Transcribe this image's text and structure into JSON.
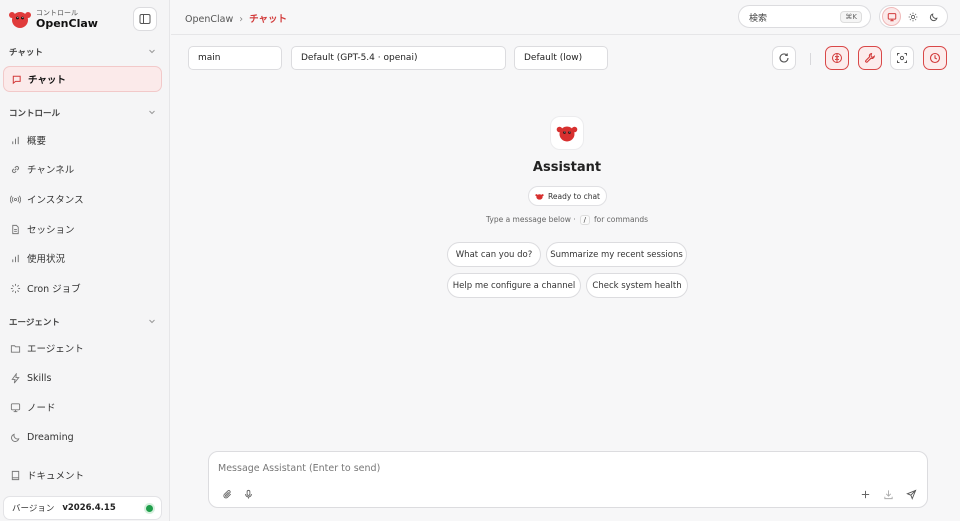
{
  "brand": {
    "subtitle": "コントロール",
    "title": "OpenClaw"
  },
  "sidebar": {
    "sections": [
      {
        "label": "チャット"
      },
      {
        "label": "コントロール"
      },
      {
        "label": "エージェント"
      }
    ],
    "items": [
      {
        "label": "チャット",
        "icon": "chat-icon"
      },
      {
        "label": "概要",
        "icon": "bar-chart-icon"
      },
      {
        "label": "チャンネル",
        "icon": "link-icon"
      },
      {
        "label": "インスタンス",
        "icon": "broadcast-icon"
      },
      {
        "label": "セッション",
        "icon": "document-icon"
      },
      {
        "label": "使用状況",
        "icon": "bar-chart-icon"
      },
      {
        "label": "Cron ジョブ",
        "icon": "loader-icon"
      },
      {
        "label": "エージェント",
        "icon": "folder-icon"
      },
      {
        "label": "Skills",
        "icon": "bolt-icon"
      },
      {
        "label": "ノード",
        "icon": "monitor-icon"
      },
      {
        "label": "Dreaming",
        "icon": "moon-icon"
      },
      {
        "label": "ドキュメント",
        "icon": "book-icon"
      }
    ],
    "version_label": "バージョン",
    "version_value": "v2026.4.15"
  },
  "header": {
    "breadcrumb_root": "OpenClaw",
    "breadcrumb_sep": "›",
    "breadcrumb_current": "チャット",
    "search_label": "検索",
    "search_shortcut": "⌘K"
  },
  "toolbar": {
    "session": "main",
    "model": "Default (GPT-5.4 · openai)",
    "thinking": "Default (low)"
  },
  "welcome": {
    "name": "Assistant",
    "status": "Ready to chat",
    "hint_before": "Type a message below ·",
    "hint_key": "/",
    "hint_after": "for commands",
    "suggestions": [
      "What can you do?",
      "Summarize my recent sessions",
      "Help me configure a channel",
      "Check system health"
    ]
  },
  "composer": {
    "placeholder": "Message Assistant (Enter to send)"
  },
  "colors": {
    "accent": "#d23a3a",
    "status_online": "#1e9e4a"
  }
}
